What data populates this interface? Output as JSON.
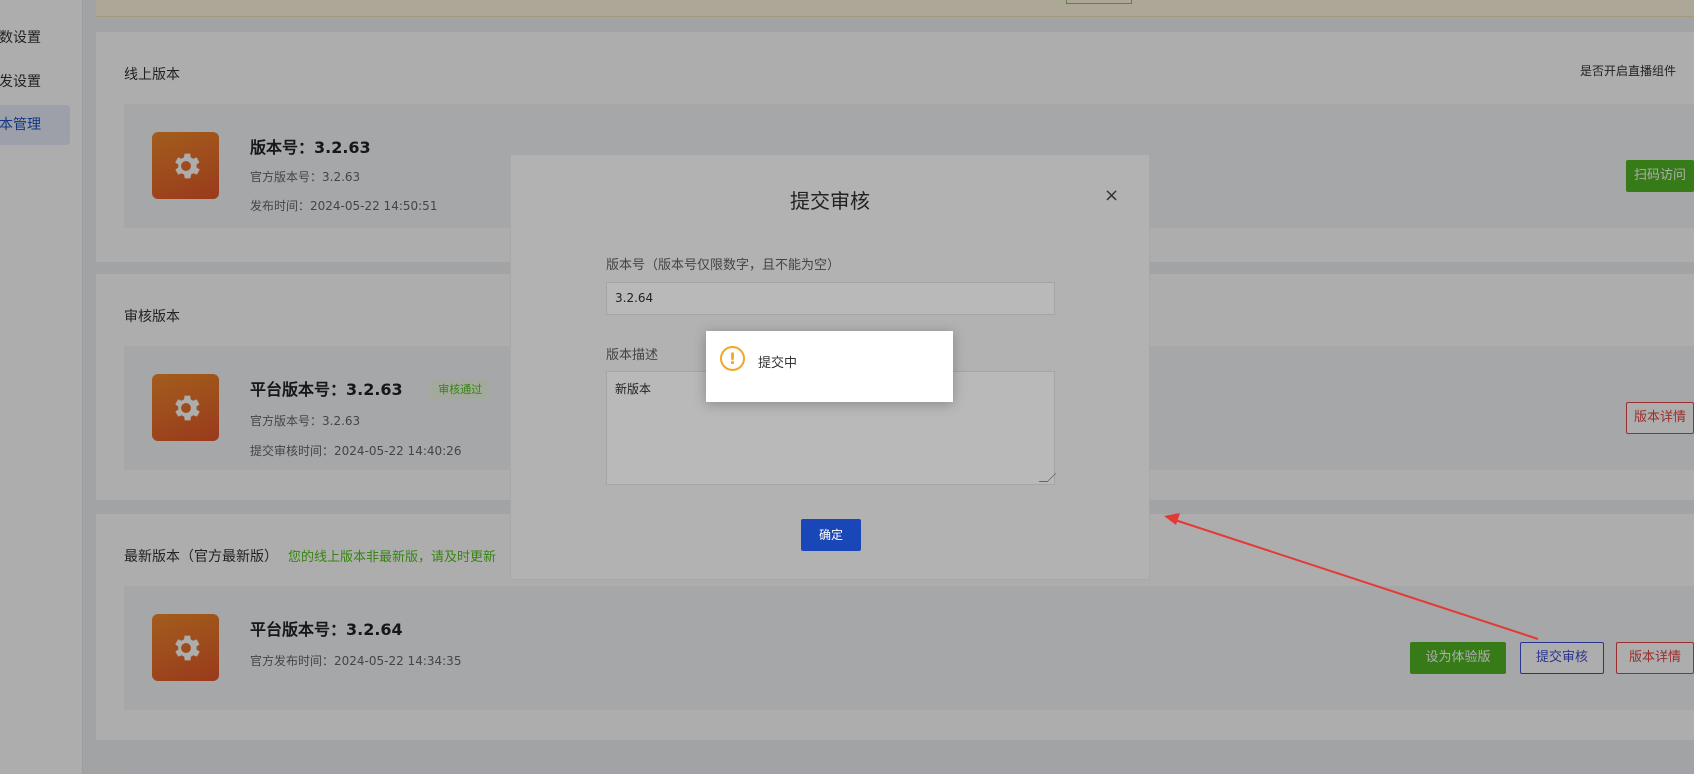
{
  "sidebar": {
    "items": [
      {
        "label": "数设置"
      },
      {
        "label": "发设置"
      },
      {
        "label": "本管理"
      }
    ]
  },
  "online": {
    "title": "线上版本",
    "live_toggle_label": "是否开启直播组件",
    "version_label": "版本号：3.2.63",
    "official_label": "官方版本号：3.2.63",
    "publish_time": "发布时间：2024-05-22 14:50:51",
    "scan_button": "扫码访问"
  },
  "review": {
    "title": "审核版本",
    "version_label": "平台版本号：3.2.63",
    "badge": "审核通过",
    "official_label": "官方版本号：3.2.63",
    "submit_time": "提交审核时间：2024-05-22 14:40:26",
    "detail_button": "版本详情"
  },
  "latest": {
    "title": "最新版本（官方最新版）",
    "hint": "您的线上版本非最新版，请及时更新",
    "version_label": "平台版本号：3.2.64",
    "publish_time": "官方发布时间：2024-05-22 14:34:35",
    "set_trial_button": "设为体验版",
    "submit_review_button": "提交审核",
    "detail_button": "版本详情"
  },
  "modal": {
    "title": "提交审核",
    "close_glyph": "×",
    "version_field_label": "版本号（版本号仅限数字，且不能为空）",
    "version_value": "3.2.64",
    "desc_field_label": "版本描述",
    "desc_value": "新版本",
    "confirm_button": "确定"
  },
  "toast": {
    "icon_glyph": "!",
    "message": "提交中"
  },
  "colors": {
    "accent_blue": "#1a47b8",
    "green": "#52b626",
    "red": "#e54545",
    "warning": "#f5a623",
    "arrow": "#e53935"
  },
  "icons": {
    "app_icon": "gear-icon",
    "toast_icon": "warning-circle-icon",
    "close": "close-icon"
  }
}
